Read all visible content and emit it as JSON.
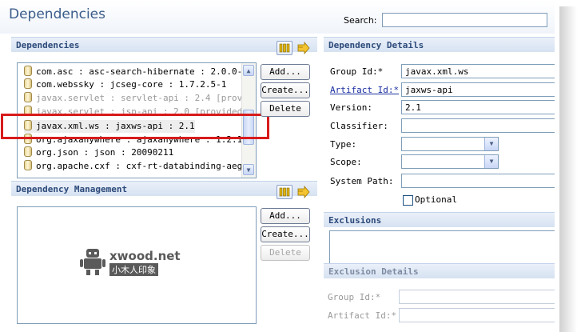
{
  "page": {
    "title": "Dependencies",
    "search_label": "Search:",
    "search_value": ""
  },
  "dependencies": {
    "header": "Dependencies",
    "items": [
      {
        "label": "com.asc : asc-search-hibernate : 2.0.0-...",
        "provided": false
      },
      {
        "label": "com.webssky : jcseg-core : 1.7.2.5-1",
        "provided": false
      },
      {
        "label": "javax.servlet : servlet-api : 2.4 [prov...",
        "provided": true
      },
      {
        "label": "javax.servlet : jsp-api : 2.0 [provided]",
        "provided": true
      },
      {
        "label": "javax.xml.ws : jaxws-api : 2.1",
        "provided": false,
        "selected": true
      },
      {
        "label": "org.ajaxanywhere : ajaxanywhere : 1.2.1",
        "provided": false
      },
      {
        "label": "org.json : json : 20090211",
        "provided": false
      },
      {
        "label": "org.apache.cxf : cxf-rt-databinding-aeg...",
        "provided": false
      }
    ],
    "buttons": {
      "add": "Add...",
      "create": "Create...",
      "delete": "Delete"
    }
  },
  "management": {
    "header": "Dependency Management",
    "buttons": {
      "add": "Add...",
      "create": "Create...",
      "delete": "Delete"
    }
  },
  "details": {
    "header": "Dependency Details",
    "group_id_label": "Group Id:*",
    "group_id_value": "javax.xml.ws",
    "artifact_id_label": "Artifact Id:*",
    "artifact_id_value": "jaxws-api",
    "version_label": "Version:",
    "version_value": "2.1",
    "classifier_label": "Classifier:",
    "classifier_value": "",
    "type_label": "Type:",
    "type_value": "",
    "scope_label": "Scope:",
    "scope_value": "",
    "system_path_label": "System Path:",
    "system_path_value": "",
    "optional_label": "Optional"
  },
  "exclusions": {
    "header": "Exclusions"
  },
  "exclusion_details": {
    "header": "Exclusion Details",
    "group_id_label": "Group Id:*",
    "artifact_id_label": "Artifact Id:*"
  },
  "watermark": {
    "brand": "xwood.net",
    "sub": "小木人印象"
  },
  "colors": {
    "accent": "#2d4a7a",
    "highlight": "#d81b1b",
    "title": "#3b5d8a"
  },
  "icons": {
    "jar": "jar-icon",
    "columns": "columns-icon",
    "filter": "filter-arrow-icon",
    "chevron_up": "chevron-up-icon",
    "chevron_down": "chevron-down-icon"
  }
}
